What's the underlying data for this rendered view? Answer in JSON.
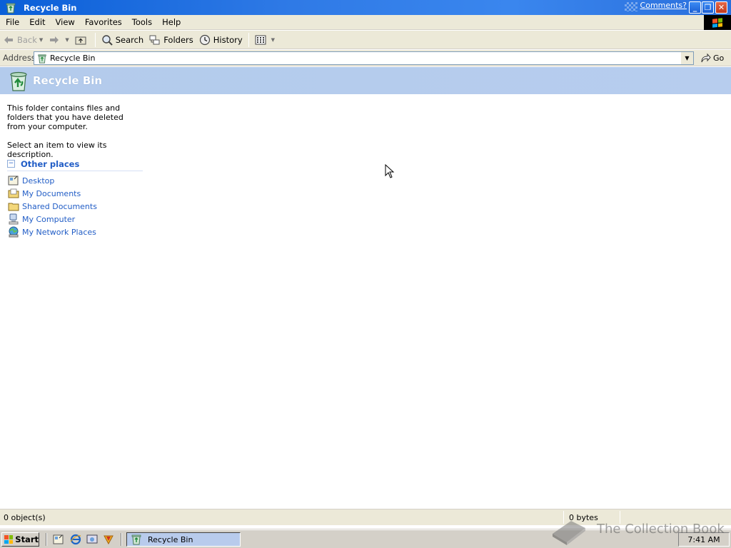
{
  "window": {
    "title": "Recycle Bin",
    "comments_link": "Comments?"
  },
  "menu": [
    "File",
    "Edit",
    "View",
    "Favorites",
    "Tools",
    "Help"
  ],
  "toolbar": {
    "back": "Back",
    "search": "Search",
    "folders": "Folders",
    "history": "History"
  },
  "address": {
    "label": "Address",
    "value": "Recycle Bin",
    "go": "Go"
  },
  "banner": {
    "title": "Recycle Bin"
  },
  "taskpane": {
    "description": "This folder contains files and folders that you have deleted from your computer.",
    "hint": "Select an item to view its description.",
    "other_places_title": "Other places",
    "other_places": [
      {
        "label": "Desktop",
        "icon": "desktop-icon"
      },
      {
        "label": "My Documents",
        "icon": "my-documents-icon"
      },
      {
        "label": "Shared Documents",
        "icon": "folder-icon"
      },
      {
        "label": "My Computer",
        "icon": "my-computer-icon"
      },
      {
        "label": "My Network Places",
        "icon": "network-places-icon"
      }
    ]
  },
  "status": {
    "objects": "0 object(s)",
    "size": "0 bytes"
  },
  "taskbar": {
    "start": "Start",
    "task_button": "Recycle Bin",
    "clock": "7:41 AM"
  },
  "watermark": {
    "text": "The Collection Book"
  },
  "colors": {
    "titlebar": "#2f7ae6",
    "banner": "#b3cbec",
    "link": "#215dc6",
    "chrome": "#ece9d8"
  }
}
